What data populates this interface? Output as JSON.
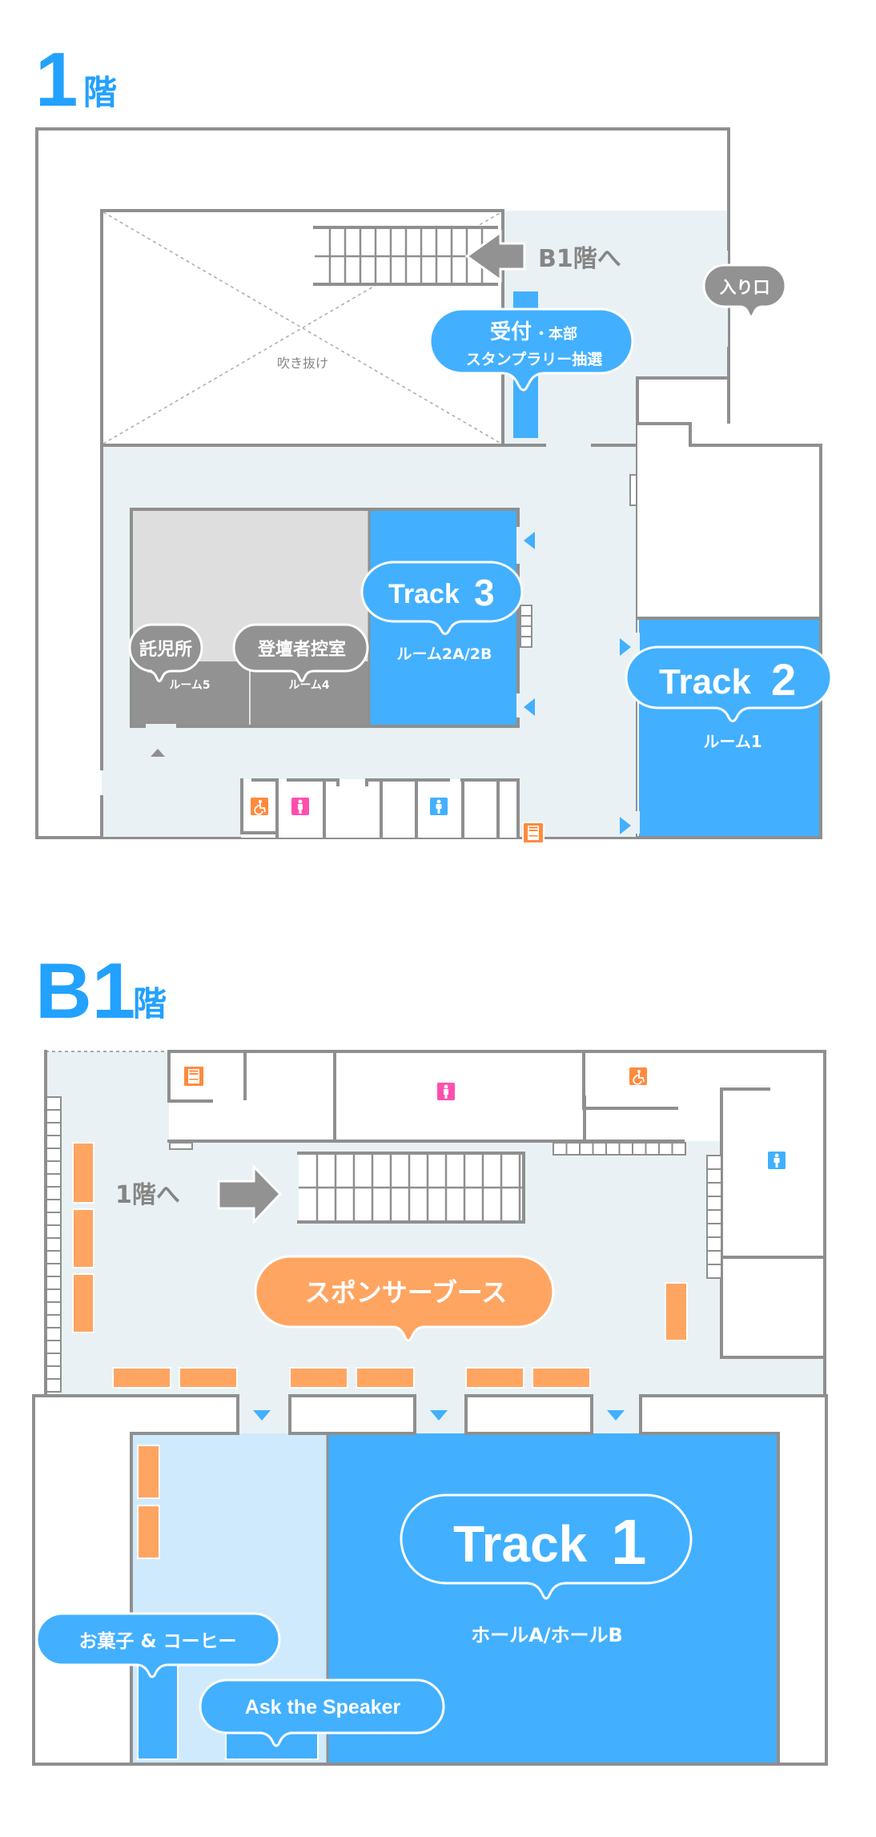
{
  "floors": {
    "f1": {
      "number": "1",
      "suffix": "階",
      "void_label": "吹き抜け",
      "to_other_floor": "B1階へ",
      "entrance_label": "入り口",
      "reception": {
        "line1": "受付",
        "line1_sub": "・本部",
        "line2": "スタンプラリー抽選"
      },
      "track3": {
        "track_word": "Track",
        "track_num": "3",
        "room": "ルーム2A/2B"
      },
      "track2": {
        "track_word": "Track",
        "track_num": "2",
        "room": "ルーム1"
      },
      "nursery": {
        "label": "託児所",
        "room": "ルーム5"
      },
      "speaker_room": {
        "label": "登壇者控室",
        "room": "ルーム4"
      },
      "icons": [
        "wheelchair-restroom-icon",
        "womens-restroom-icon",
        "mens-restroom-icon",
        "vending-machine-icon"
      ]
    },
    "b1": {
      "number": "B1",
      "suffix": "階",
      "to_other_floor": "1階へ",
      "sponsor_label": "スポンサーブース",
      "track1": {
        "track_word": "Track",
        "track_num": "1",
        "room": "ホールA/ホールB"
      },
      "snack_label": "お菓子 & コーヒー",
      "ask_label": "Ask the Speaker",
      "icons": [
        "vending-machine-icon",
        "womens-restroom-icon",
        "wheelchair-restroom-icon",
        "mens-restroom-icon"
      ]
    }
  },
  "colors": {
    "accent_blue": "#22a1ff",
    "track_blue": "#42b0ff",
    "sponsor_orange": "#ffa562",
    "wall_gray": "#8f8f8f",
    "floor": "#e9f1f4",
    "womens_pink": "#ff4fae",
    "wheelchair_orange": "#ff8a3d"
  }
}
